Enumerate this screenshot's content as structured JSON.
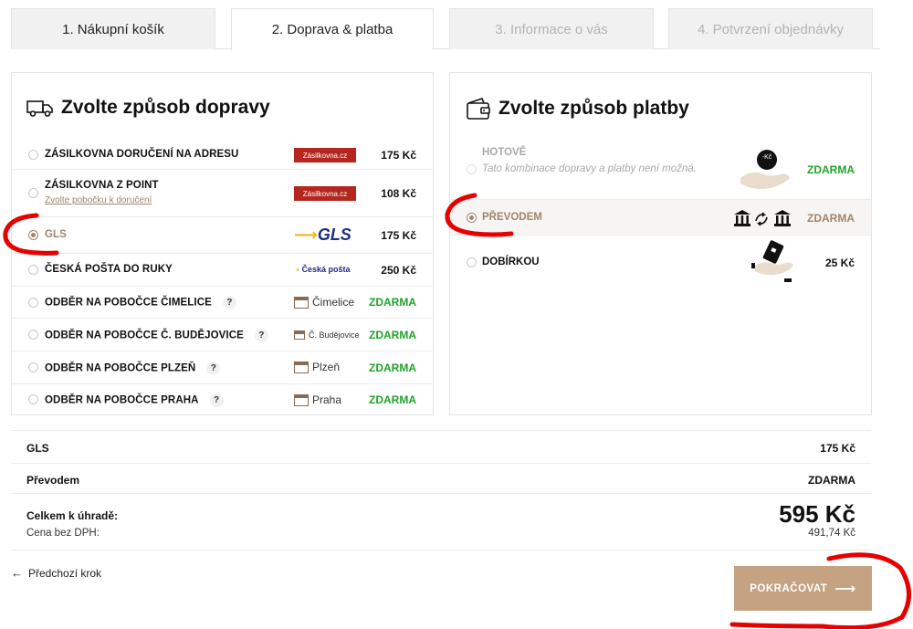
{
  "tabs": [
    {
      "label": "1. Nákupní košík"
    },
    {
      "label": "2. Doprava & platba"
    },
    {
      "label": "3. Informace o vás"
    },
    {
      "label": "4. Potvrzení objednávky"
    }
  ],
  "shipping": {
    "title": "Zvolte způsob dopravy",
    "options": [
      {
        "label": "ZÁSILKOVNA DORUČENÍ NA ADRESU",
        "logo": "Zásilkovna.cz",
        "price": "175 Kč"
      },
      {
        "label": "ZÁSILKOVNA Z POINT",
        "sub": "Zvolte pobočku k doručení",
        "logo": "Zásilkovna.cz",
        "price": "108 Kč"
      },
      {
        "label": "GLS",
        "logo": "GLS",
        "price": "175 Kč"
      },
      {
        "label": "ČESKÁ POŠTA DO RUKY",
        "logo": "Česká pošta",
        "price": "250 Kč"
      },
      {
        "label": "ODBĚR NA POBOČCE ČIMELICE",
        "help": "?",
        "branch": "Čimelice",
        "price": "ZDARMA"
      },
      {
        "label": "ODBĚR NA POBOČCE Č. BUDĚJOVICE",
        "help": "?",
        "branch": "Č. Budějovice",
        "price": "ZDARMA"
      },
      {
        "label": "ODBĚR NA POBOČCE PLZEŇ",
        "help": "?",
        "branch": "Plzeň",
        "price": "ZDARMA"
      },
      {
        "label": "ODBĚR NA POBOČCE PRAHA",
        "help": "?",
        "branch": "Praha",
        "price": "ZDARMA"
      }
    ]
  },
  "payment": {
    "title": "Zvolte způsob platby",
    "options": [
      {
        "label": "HOTOVĚ",
        "note": "Tato kombinace dopravy a platby není možná.",
        "icon_text": "-Kč",
        "price": "ZDARMA"
      },
      {
        "label": "PŘEVODEM",
        "price": "ZDARMA"
      },
      {
        "label": "DOBÍRKOU",
        "price": "25 Kč"
      }
    ]
  },
  "summary": {
    "shipping_label": "GLS",
    "shipping_value": "175 Kč",
    "payment_label": "Převodem",
    "payment_value": "ZDARMA",
    "total_label": "Celkem k úhradě:",
    "total_value": "595 Kč",
    "net_label": "Cena bez DPH:",
    "net_value": "491,74 Kč"
  },
  "nav": {
    "back_label": "Předchozí krok",
    "continue_label": "POKRAČOVAT"
  },
  "colors": {
    "accent": "#a0856a",
    "button": "#c4a282",
    "free": "#1fa42b",
    "annotation": "#e60000"
  }
}
